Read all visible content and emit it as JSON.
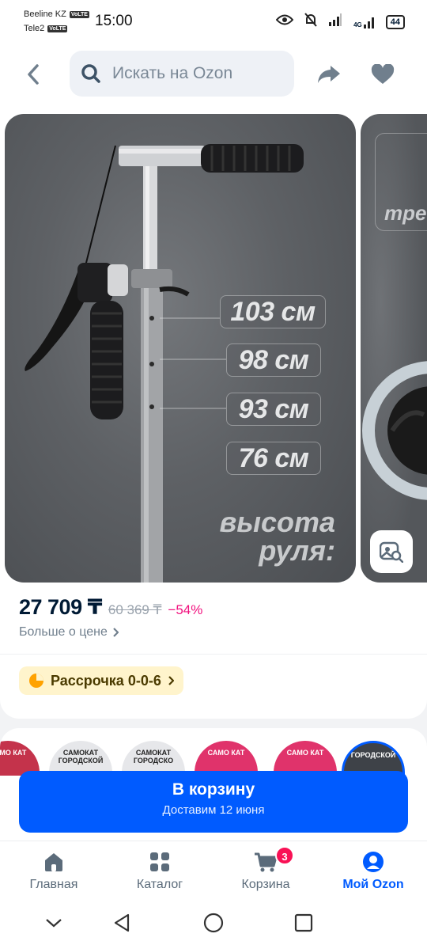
{
  "status_bar": {
    "carrier1": "Beeline KZ",
    "carrier2": "Tele2",
    "volte": "VoLTE",
    "time": "15:00",
    "network": "4G",
    "battery": "44"
  },
  "header": {
    "search_placeholder": "Искать на Ozon",
    "back_icon": "chevron-left-icon",
    "share_icon": "share-icon",
    "favorite_icon": "heart-icon"
  },
  "gallery": {
    "heights": [
      "103 см",
      "98 см",
      "93 см",
      "76 см"
    ],
    "caption_line1": "высота",
    "caption_line2": "руля:",
    "next_slide_text": "тре"
  },
  "price": {
    "current": "27 709 ₸",
    "old": "60 369 ₸",
    "discount": "−54%",
    "more_link": "Больше о цене"
  },
  "installment": {
    "label": "Рассрочка 0-0-6"
  },
  "thumbnails": [
    {
      "text": "САМО КАТ",
      "style": "red"
    },
    {
      "text": "САМОКАТ ГОРОДСКОЙ",
      "style": "light"
    },
    {
      "text": "САМОКАТ ГОРОДСКО",
      "style": "light"
    },
    {
      "text": "САМО КАТ",
      "style": "red"
    },
    {
      "text": "САМО КАТ",
      "style": "red"
    },
    {
      "text": "ГОРОДСКОЙ",
      "style": "dark"
    }
  ],
  "cart": {
    "title": "В корзину",
    "subtitle": "Доставим 12 июня"
  },
  "nav": {
    "items": [
      {
        "label": "Главная",
        "icon": "home-icon"
      },
      {
        "label": "Каталог",
        "icon": "catalog-icon"
      },
      {
        "label": "Корзина",
        "icon": "cart-icon",
        "badge": "3"
      },
      {
        "label": "Мой Ozon",
        "icon": "profile-icon"
      }
    ],
    "active_index": 3
  },
  "colors": {
    "accent": "#005bff",
    "discount": "#f1117e",
    "badge": "#f91155",
    "installment_bg": "#fff4cc"
  }
}
